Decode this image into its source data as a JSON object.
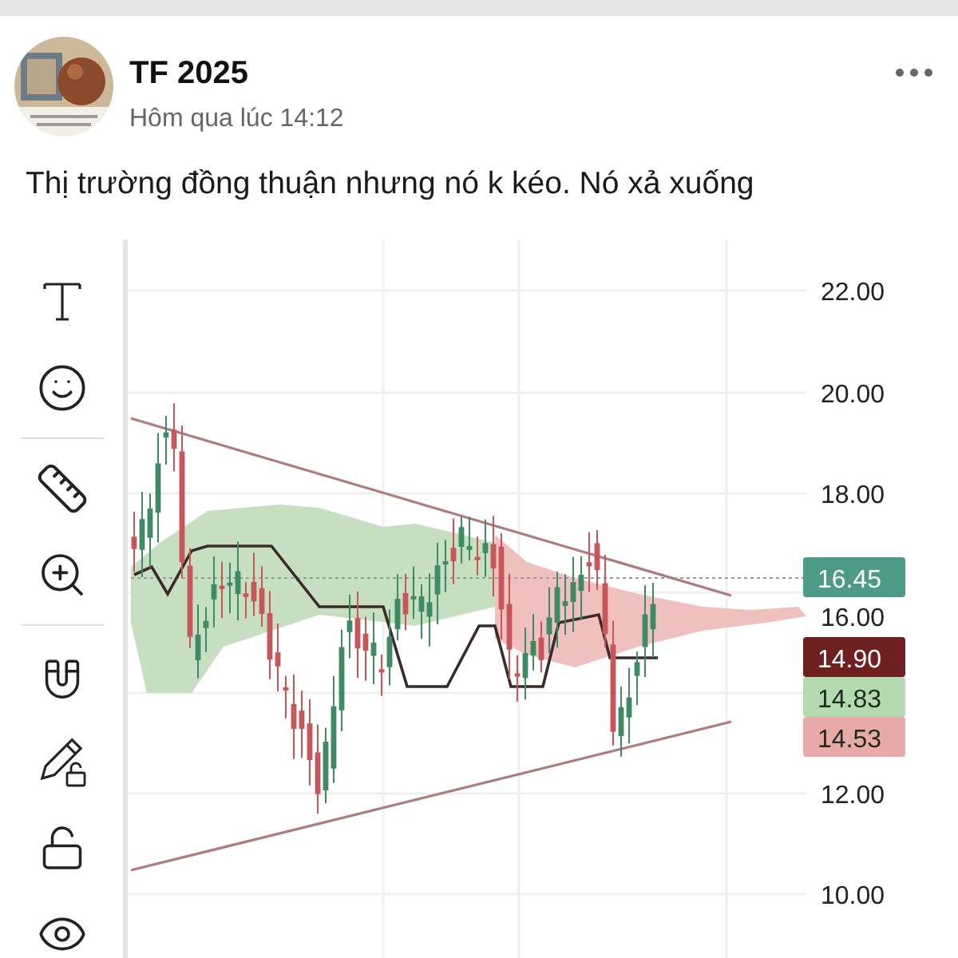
{
  "post": {
    "author": "TF 2025",
    "timestamp": "Hôm qua lúc 14:12",
    "text": "Thị trường đồng thuận nhưng nó k kéo. Nó xả xuống"
  },
  "chart": {
    "price_axis": [
      "22.00",
      "20.00",
      "18.00",
      "16.00",
      "12.00",
      "10.00"
    ],
    "price_badges": [
      {
        "value": "16.45",
        "color": "#4e9a88"
      },
      {
        "value": "14.90",
        "color": "#6e1f1f"
      },
      {
        "value": "14.83",
        "color": "#b5d9b0"
      },
      {
        "value": "14.53",
        "color": "#e8aaa9"
      }
    ]
  }
}
